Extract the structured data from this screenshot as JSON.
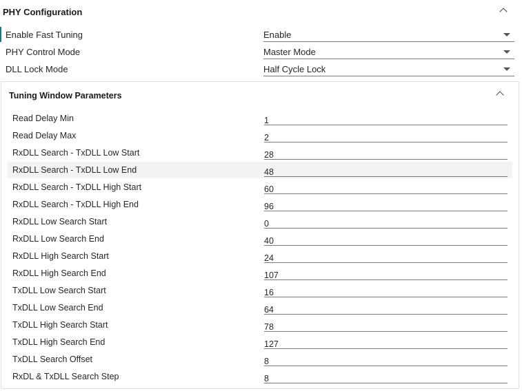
{
  "phy_config": {
    "title": "PHY Configuration",
    "fields": [
      {
        "label": "Enable Fast Tuning",
        "value": "Enable"
      },
      {
        "label": "PHY Control Mode",
        "value": "Master Mode"
      },
      {
        "label": "DLL Lock Mode",
        "value": "Half Cycle Lock"
      }
    ]
  },
  "tuning": {
    "title": "Tuning Window Parameters",
    "params": [
      {
        "label": "Read Delay Min",
        "value": "1"
      },
      {
        "label": "Read Delay Max",
        "value": "2"
      },
      {
        "label": "RxDLL Search - TxDLL Low Start",
        "value": "28"
      },
      {
        "label": "RxDLL Search - TxDLL Low End",
        "value": "48"
      },
      {
        "label": "RxDLL Search - TxDLL High Start",
        "value": "60"
      },
      {
        "label": "RxDLL Search - TxDLL High End",
        "value": "96"
      },
      {
        "label": "RxDLL Low Search Start",
        "value": "0"
      },
      {
        "label": "RxDLL Low Search End",
        "value": "40"
      },
      {
        "label": "RxDLL High Search Start",
        "value": "24"
      },
      {
        "label": "RxDLL High Search End",
        "value": "107"
      },
      {
        "label": "TxDLL Low Search Start",
        "value": "16"
      },
      {
        "label": "TxDLL Low Search End",
        "value": "64"
      },
      {
        "label": "TxDLL High Search Start",
        "value": "78"
      },
      {
        "label": "TxDLL High Search End",
        "value": "127"
      },
      {
        "label": "TxDLL Search Offset",
        "value": "8"
      },
      {
        "label": "RxDL & TxDLL Search Step",
        "value": "8"
      }
    ]
  },
  "colors": {
    "accent": "#117a8b",
    "row_highlight": "#f3f3f3"
  }
}
